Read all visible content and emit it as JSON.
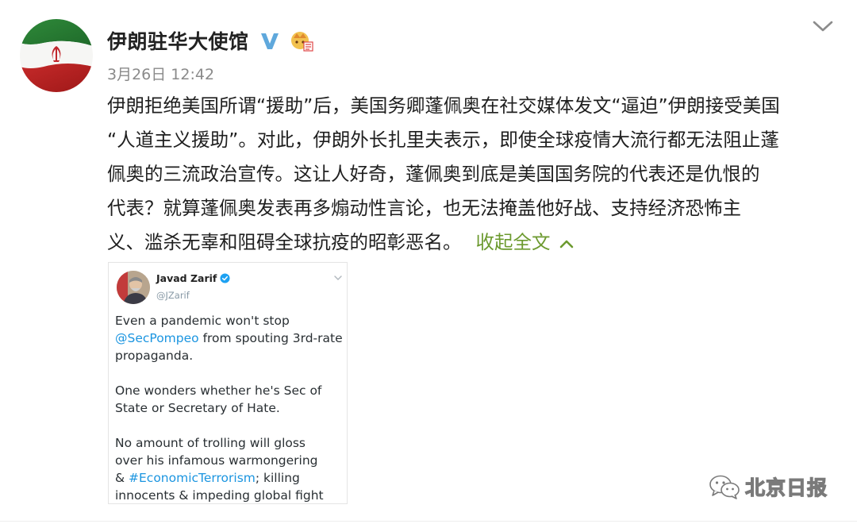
{
  "post": {
    "account_name": "伊朗驻华大使馆",
    "timestamp": "3月26日 12:42",
    "text_lines": [
      "伊朗拒绝美国所谓“援助”后，美国务卿蓬佩奥在社交媒体发文“逼迫”伊朗接受美国",
      "“人道主义援助”。对此，伊朗外长扎里夫表示，即使全球疫情大流行都无法阻止蓬",
      "佩奥的三流政治宣传。这让人好奇，蓬佩奥到底是美国国务院的代表还是仇恨的",
      "代表？就算蓬佩奥发表再多煽动性言论，也无法掩盖他好战、支持经济恐怖主",
      "义、滥杀无辜和阻碍全球抗疫的昭彰恶名。"
    ],
    "collapse_label": "收起全文",
    "icons": {
      "avatar": "iran-flag-avatar",
      "verified": "verified-v-icon",
      "member": "member-crown-icon",
      "menu": "chevron-down-icon",
      "collapse": "chevron-up-icon"
    },
    "colors": {
      "link": "#6c9a2f",
      "verified": "#5fa8dc"
    }
  },
  "tweet": {
    "name": "Javad Zarif",
    "handle": "@JZarif",
    "para1_pre": "Even a pandemic won't stop",
    "para1_mention": "@SecPompeo",
    "para1_post": " from spouting 3rd-rate",
    "para1_line3": "propaganda.",
    "para2_line1": "One wonders whether he's Sec of",
    "para2_line2": "State or Secretary of Hate.",
    "para3_line1": "No amount of trolling will gloss",
    "para3_line2": "over his infamous warmongering",
    "para3_pre": "& ",
    "para3_hashtag": "#EconomicTerrorism",
    "para3_post": "; killing",
    "para3_line4": "innocents & impeding global fight",
    "colors": {
      "link": "#1b95e0"
    }
  },
  "watermark": {
    "text": "北京日报",
    "icon": "wechat-icon"
  }
}
